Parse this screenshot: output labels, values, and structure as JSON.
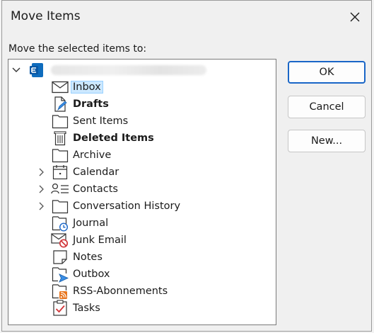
{
  "dialog": {
    "title": "Move Items",
    "prompt": "Move the selected items to:",
    "buttons": {
      "ok": "OK",
      "cancel": "Cancel",
      "new": "New..."
    },
    "account_name": "",
    "folders": [
      {
        "label": "Inbox",
        "icon": "envelope-icon",
        "bold": false,
        "selected": true,
        "expandable": false
      },
      {
        "label": "Drafts",
        "icon": "draft-pencil-icon",
        "bold": true,
        "selected": false,
        "expandable": false
      },
      {
        "label": "Sent Items",
        "icon": "folder-icon",
        "bold": false,
        "selected": false,
        "expandable": false
      },
      {
        "label": "Deleted Items",
        "icon": "trash-icon",
        "bold": true,
        "selected": false,
        "expandable": false
      },
      {
        "label": "Archive",
        "icon": "folder-icon",
        "bold": false,
        "selected": false,
        "expandable": false
      },
      {
        "label": "Calendar",
        "icon": "calendar-icon",
        "bold": false,
        "selected": false,
        "expandable": true
      },
      {
        "label": "Contacts",
        "icon": "contacts-icon",
        "bold": false,
        "selected": false,
        "expandable": true
      },
      {
        "label": "Conversation History",
        "icon": "folder-icon",
        "bold": false,
        "selected": false,
        "expandable": true
      },
      {
        "label": "Journal",
        "icon": "journal-clock-icon",
        "bold": false,
        "selected": false,
        "expandable": false
      },
      {
        "label": "Junk Email",
        "icon": "junk-email-icon",
        "bold": false,
        "selected": false,
        "expandable": false
      },
      {
        "label": "Notes",
        "icon": "note-icon",
        "bold": false,
        "selected": false,
        "expandable": false
      },
      {
        "label": "Outbox",
        "icon": "outbox-icon",
        "bold": false,
        "selected": false,
        "expandable": false
      },
      {
        "label": "RSS-Abonnements",
        "icon": "rss-folder-icon",
        "bold": false,
        "selected": false,
        "expandable": false
      },
      {
        "label": "Tasks",
        "icon": "tasks-icon",
        "bold": false,
        "selected": false,
        "expandable": false
      }
    ]
  },
  "colors": {
    "accent": "#1a66c7",
    "selection_bg": "#cce8ff",
    "exchange_blue": "#0f6cbd",
    "junk_red": "#d13438",
    "rss_orange": "#e8741c"
  }
}
